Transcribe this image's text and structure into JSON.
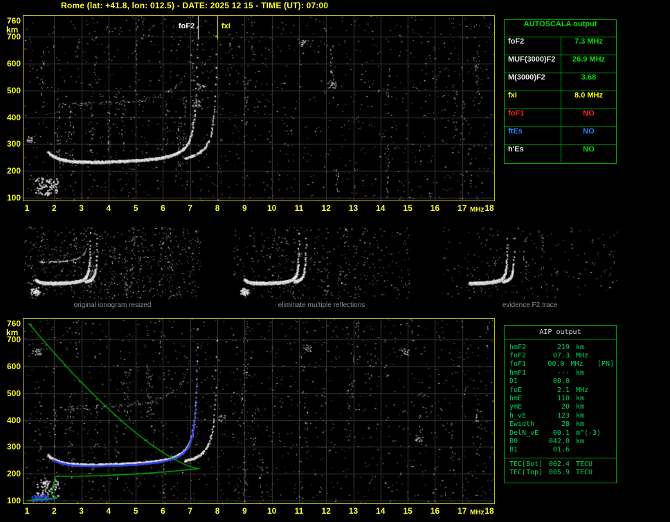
{
  "header": {
    "title": "Rome (lat: +41.8, lon: 012.5) - DATE: 2025 12 15 - TIME (UT): 07:00"
  },
  "plot": {
    "x_label": "MHz",
    "y_label": "km",
    "x_ticks": [
      1,
      2,
      3,
      4,
      5,
      6,
      7,
      8,
      9,
      10,
      11,
      12,
      13,
      14,
      15,
      16,
      17,
      18
    ],
    "y_ticks": [
      760,
      700,
      600,
      500,
      400,
      300,
      200,
      100
    ],
    "foF2_mhz": 7.3,
    "fxI_mhz": 8.0,
    "foE_mhz": 2.1,
    "hmF2_km": 219,
    "marker_foF2_label": "foF2",
    "marker_fxI_label": "fxI",
    "colors": {
      "axis": "#ffff2e",
      "frame": "#b9b921",
      "grid": "#3a3a3a",
      "trace": "#ffffff",
      "fit": "#3344ee",
      "profile": "#00b400"
    }
  },
  "autoscala": {
    "title": "AUTOSCALA output",
    "rows": [
      {
        "label": "foF2",
        "value": "7.3 MHz",
        "label_color": "#e8e8e8",
        "value_color": "#00e000"
      },
      {
        "label": "MUF(3000)F2",
        "value": "26.9 MHz",
        "label_color": "#e8e8e8",
        "value_color": "#00e000"
      },
      {
        "label": "M(3000)F2",
        "value": "3.68",
        "label_color": "#e8e8e8",
        "value_color": "#00e000"
      },
      {
        "label": "fxI",
        "value": "8.0 MHz",
        "label_color": "#ffff00",
        "value_color": "#ffff00"
      },
      {
        "label": "foF1",
        "value": "NO",
        "label_color": "#ff2222",
        "value_color": "#ff2222"
      },
      {
        "label": "ftEs",
        "value": "NO",
        "label_color": "#2f7fff",
        "value_color": "#2f7fff"
      },
      {
        "label": "h'Es",
        "value": "NO",
        "label_color": "#e8e8e8",
        "value_color": "#00e000"
      }
    ]
  },
  "thumbnails": [
    {
      "caption": "original ionogram resized"
    },
    {
      "caption": "eliminate multiple reflections"
    },
    {
      "caption": "evidence F2 trace"
    }
  ],
  "aip": {
    "title": "AIP output",
    "rows": [
      {
        "label": "hmF2",
        "value": "219",
        "unit": "km",
        "extra": ""
      },
      {
        "label": "foF2",
        "value": "07.3",
        "unit": "MHz",
        "extra": ""
      },
      {
        "label": "foF1",
        "value": "00.0",
        "unit": "MHz",
        "extra": "[PN]"
      },
      {
        "label": "hmF1",
        "value": "---",
        "unit": "km",
        "extra": ""
      },
      {
        "label": "D1",
        "value": "00.0",
        "unit": "",
        "extra": ""
      },
      {
        "label": "foE",
        "value": "2.1",
        "unit": "MHz",
        "extra": ""
      },
      {
        "label": "hmE",
        "value": "110",
        "unit": "km",
        "extra": ""
      },
      {
        "label": "ymE",
        "value": "20",
        "unit": "km",
        "extra": ""
      },
      {
        "label": "h_vE",
        "value": "123",
        "unit": "km",
        "extra": ""
      },
      {
        "label": "Ewidth",
        "value": "28",
        "unit": "km",
        "extra": ""
      },
      {
        "label": "DelN_vE",
        "value": "00.1",
        "unit": "m^(-3)",
        "extra": ""
      },
      {
        "label": "B0",
        "value": "042.0",
        "unit": "km",
        "extra": ""
      },
      {
        "label": "B1",
        "value": "01.6",
        "unit": "",
        "extra": ""
      }
    ],
    "tec_rows": [
      {
        "label": "TEC[Bot]",
        "value": "002.4",
        "unit": "TECU"
      },
      {
        "label": "TEC[Top]",
        "value": "005.9",
        "unit": "TECU"
      }
    ]
  }
}
